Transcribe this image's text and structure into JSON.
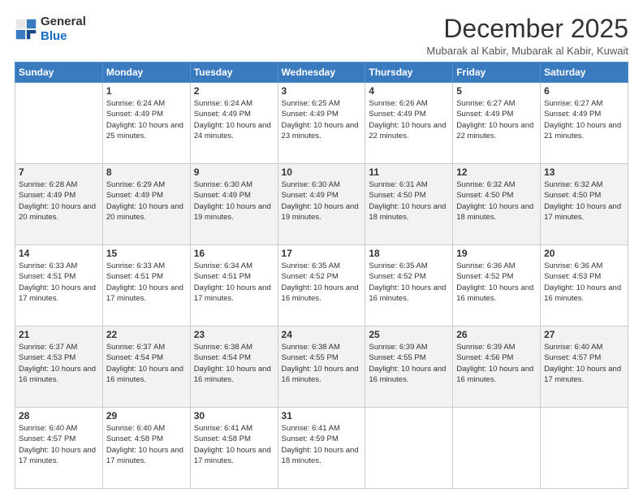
{
  "logo": {
    "general": "General",
    "blue": "Blue"
  },
  "header": {
    "title": "December 2025",
    "subtitle": "Mubarak al Kabir, Mubarak al Kabir, Kuwait"
  },
  "days_of_week": [
    "Sunday",
    "Monday",
    "Tuesday",
    "Wednesday",
    "Thursday",
    "Friday",
    "Saturday"
  ],
  "weeks": [
    [
      {
        "day": "",
        "sunrise": "",
        "sunset": "",
        "daylight": ""
      },
      {
        "day": "1",
        "sunrise": "Sunrise: 6:24 AM",
        "sunset": "Sunset: 4:49 PM",
        "daylight": "Daylight: 10 hours and 25 minutes."
      },
      {
        "day": "2",
        "sunrise": "Sunrise: 6:24 AM",
        "sunset": "Sunset: 4:49 PM",
        "daylight": "Daylight: 10 hours and 24 minutes."
      },
      {
        "day": "3",
        "sunrise": "Sunrise: 6:25 AM",
        "sunset": "Sunset: 4:49 PM",
        "daylight": "Daylight: 10 hours and 23 minutes."
      },
      {
        "day": "4",
        "sunrise": "Sunrise: 6:26 AM",
        "sunset": "Sunset: 4:49 PM",
        "daylight": "Daylight: 10 hours and 22 minutes."
      },
      {
        "day": "5",
        "sunrise": "Sunrise: 6:27 AM",
        "sunset": "Sunset: 4:49 PM",
        "daylight": "Daylight: 10 hours and 22 minutes."
      },
      {
        "day": "6",
        "sunrise": "Sunrise: 6:27 AM",
        "sunset": "Sunset: 4:49 PM",
        "daylight": "Daylight: 10 hours and 21 minutes."
      }
    ],
    [
      {
        "day": "7",
        "sunrise": "Sunrise: 6:28 AM",
        "sunset": "Sunset: 4:49 PM",
        "daylight": "Daylight: 10 hours and 20 minutes."
      },
      {
        "day": "8",
        "sunrise": "Sunrise: 6:29 AM",
        "sunset": "Sunset: 4:49 PM",
        "daylight": "Daylight: 10 hours and 20 minutes."
      },
      {
        "day": "9",
        "sunrise": "Sunrise: 6:30 AM",
        "sunset": "Sunset: 4:49 PM",
        "daylight": "Daylight: 10 hours and 19 minutes."
      },
      {
        "day": "10",
        "sunrise": "Sunrise: 6:30 AM",
        "sunset": "Sunset: 4:49 PM",
        "daylight": "Daylight: 10 hours and 19 minutes."
      },
      {
        "day": "11",
        "sunrise": "Sunrise: 6:31 AM",
        "sunset": "Sunset: 4:50 PM",
        "daylight": "Daylight: 10 hours and 18 minutes."
      },
      {
        "day": "12",
        "sunrise": "Sunrise: 6:32 AM",
        "sunset": "Sunset: 4:50 PM",
        "daylight": "Daylight: 10 hours and 18 minutes."
      },
      {
        "day": "13",
        "sunrise": "Sunrise: 6:32 AM",
        "sunset": "Sunset: 4:50 PM",
        "daylight": "Daylight: 10 hours and 17 minutes."
      }
    ],
    [
      {
        "day": "14",
        "sunrise": "Sunrise: 6:33 AM",
        "sunset": "Sunset: 4:51 PM",
        "daylight": "Daylight: 10 hours and 17 minutes."
      },
      {
        "day": "15",
        "sunrise": "Sunrise: 6:33 AM",
        "sunset": "Sunset: 4:51 PM",
        "daylight": "Daylight: 10 hours and 17 minutes."
      },
      {
        "day": "16",
        "sunrise": "Sunrise: 6:34 AM",
        "sunset": "Sunset: 4:51 PM",
        "daylight": "Daylight: 10 hours and 17 minutes."
      },
      {
        "day": "17",
        "sunrise": "Sunrise: 6:35 AM",
        "sunset": "Sunset: 4:52 PM",
        "daylight": "Daylight: 10 hours and 16 minutes."
      },
      {
        "day": "18",
        "sunrise": "Sunrise: 6:35 AM",
        "sunset": "Sunset: 4:52 PM",
        "daylight": "Daylight: 10 hours and 16 minutes."
      },
      {
        "day": "19",
        "sunrise": "Sunrise: 6:36 AM",
        "sunset": "Sunset: 4:52 PM",
        "daylight": "Daylight: 10 hours and 16 minutes."
      },
      {
        "day": "20",
        "sunrise": "Sunrise: 6:36 AM",
        "sunset": "Sunset: 4:53 PM",
        "daylight": "Daylight: 10 hours and 16 minutes."
      }
    ],
    [
      {
        "day": "21",
        "sunrise": "Sunrise: 6:37 AM",
        "sunset": "Sunset: 4:53 PM",
        "daylight": "Daylight: 10 hours and 16 minutes."
      },
      {
        "day": "22",
        "sunrise": "Sunrise: 6:37 AM",
        "sunset": "Sunset: 4:54 PM",
        "daylight": "Daylight: 10 hours and 16 minutes."
      },
      {
        "day": "23",
        "sunrise": "Sunrise: 6:38 AM",
        "sunset": "Sunset: 4:54 PM",
        "daylight": "Daylight: 10 hours and 16 minutes."
      },
      {
        "day": "24",
        "sunrise": "Sunrise: 6:38 AM",
        "sunset": "Sunset: 4:55 PM",
        "daylight": "Daylight: 10 hours and 16 minutes."
      },
      {
        "day": "25",
        "sunrise": "Sunrise: 6:39 AM",
        "sunset": "Sunset: 4:55 PM",
        "daylight": "Daylight: 10 hours and 16 minutes."
      },
      {
        "day": "26",
        "sunrise": "Sunrise: 6:39 AM",
        "sunset": "Sunset: 4:56 PM",
        "daylight": "Daylight: 10 hours and 16 minutes."
      },
      {
        "day": "27",
        "sunrise": "Sunrise: 6:40 AM",
        "sunset": "Sunset: 4:57 PM",
        "daylight": "Daylight: 10 hours and 17 minutes."
      }
    ],
    [
      {
        "day": "28",
        "sunrise": "Sunrise: 6:40 AM",
        "sunset": "Sunset: 4:57 PM",
        "daylight": "Daylight: 10 hours and 17 minutes."
      },
      {
        "day": "29",
        "sunrise": "Sunrise: 6:40 AM",
        "sunset": "Sunset: 4:58 PM",
        "daylight": "Daylight: 10 hours and 17 minutes."
      },
      {
        "day": "30",
        "sunrise": "Sunrise: 6:41 AM",
        "sunset": "Sunset: 4:58 PM",
        "daylight": "Daylight: 10 hours and 17 minutes."
      },
      {
        "day": "31",
        "sunrise": "Sunrise: 6:41 AM",
        "sunset": "Sunset: 4:59 PM",
        "daylight": "Daylight: 10 hours and 18 minutes."
      },
      {
        "day": "",
        "sunrise": "",
        "sunset": "",
        "daylight": ""
      },
      {
        "day": "",
        "sunrise": "",
        "sunset": "",
        "daylight": ""
      },
      {
        "day": "",
        "sunrise": "",
        "sunset": "",
        "daylight": ""
      }
    ]
  ]
}
